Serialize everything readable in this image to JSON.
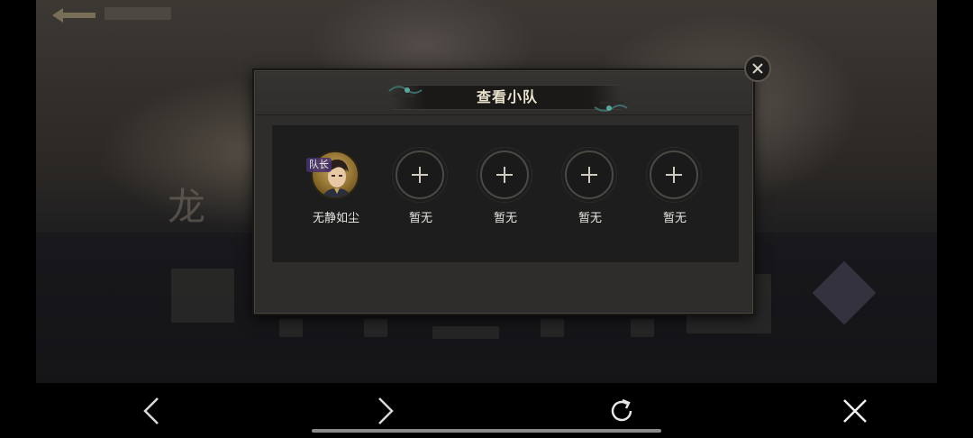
{
  "background": {
    "back_label": "",
    "bg_glyph": "龙"
  },
  "modal": {
    "title": "查看小队",
    "close_icon": "close-icon",
    "slots": [
      {
        "name": "无静如尘",
        "state": "filled",
        "leader_tag": "队长"
      },
      {
        "name": "暂无",
        "state": "empty"
      },
      {
        "name": "暂无",
        "state": "empty"
      },
      {
        "name": "暂无",
        "state": "empty"
      },
      {
        "name": "暂无",
        "state": "empty"
      }
    ]
  },
  "nav_bar": {
    "icons": [
      "back-chevron-icon",
      "forward-chevron-icon",
      "refresh-icon",
      "close-icon"
    ]
  },
  "colors": {
    "modal_bg": "#2e2d2b",
    "panel_bg": "#1d1d1d",
    "title_text": "#e9e2cf",
    "name_text": "#e8e6e1"
  }
}
